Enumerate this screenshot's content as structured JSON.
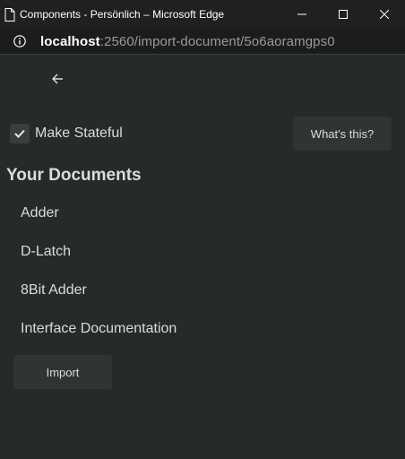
{
  "window": {
    "title": "Components - Persönlich – Microsoft Edge",
    "icons": [
      "page-icon",
      "minimize-icon",
      "maximize-icon",
      "close-icon"
    ]
  },
  "address": {
    "host": "localhost",
    "path": ":2560/import-document/5o6aoramgps0",
    "icon": "info-icon"
  },
  "toolbar": {
    "back_icon": "arrow-left-icon",
    "stateful_label": "Make Stateful",
    "stateful_checked": true,
    "whats_this_label": "What's this?"
  },
  "documents": {
    "heading": "Your Documents",
    "items": [
      "Adder",
      "D-Latch",
      "8Bit Adder",
      "Interface Documentation"
    ]
  },
  "actions": {
    "import_label": "Import"
  },
  "colors": {
    "background": "#262a2b",
    "button": "#303435",
    "text": "#dcdcdc"
  }
}
